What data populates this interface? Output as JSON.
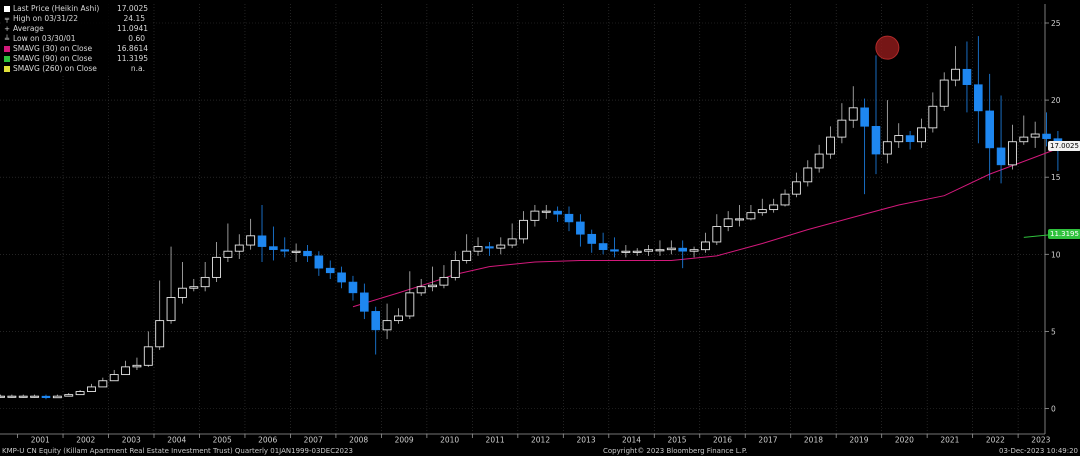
{
  "legend": {
    "last_price": {
      "label": "Last Price (Heikin Ashi)",
      "value": "17.0025"
    },
    "high": {
      "label": "High on 03/31/22",
      "value": "24.15"
    },
    "average": {
      "label": "Average",
      "value": "11.0941"
    },
    "low": {
      "label": "Low on 03/30/01",
      "value": "0.60"
    },
    "smavg30": {
      "label": "SMAVG (30)  on Close",
      "value": "16.8614"
    },
    "smavg90": {
      "label": "SMAVG (90)  on Close",
      "value": "11.3195"
    },
    "smavg260": {
      "label": "SMAVG (260)  on Close",
      "value": "n.a."
    }
  },
  "footer": {
    "left": "KMP-U CN Equity (Killam Apartment Real Estate Investment Trust)  Quarterly 01JAN1999-03DEC2023",
    "copyright": "Copyright© 2023 Bloomberg Finance L.P.",
    "timestamp": "03-Dec-2023 10:49:20"
  },
  "tags": {
    "last_price": "17.0025",
    "smavg90": "11.3195"
  },
  "colors": {
    "background": "#000000",
    "up_candle": "#e8e8e8",
    "down_candle": "#1e87f0",
    "smavg30": "#d3197b",
    "smavg90": "#2fc23d",
    "smavg260": "#e0e03a",
    "grid": "#3a3a3a",
    "high_marker": "#8b1a1a"
  },
  "chart_data": {
    "type": "candlestick",
    "style": "Heikin Ashi",
    "frequency": "Quarterly",
    "title": "",
    "xlabel": "",
    "ylabel": "",
    "ylim": [
      -1,
      26
    ],
    "yticks": [
      0,
      5,
      10,
      15,
      20,
      25
    ],
    "xticks": [
      "2001",
      "2002",
      "2003",
      "2004",
      "2005",
      "2006",
      "2007",
      "2008",
      "2009",
      "2010",
      "2011",
      "2012",
      "2013",
      "2014",
      "2015",
      "2016",
      "2017",
      "2018",
      "2019",
      "2020",
      "2021",
      "2022",
      "2023"
    ],
    "grid": true,
    "legend_position": "top-left",
    "quarters": [
      "2000Q3",
      "2000Q4",
      "2001Q1",
      "2001Q2",
      "2001Q3",
      "2001Q4",
      "2002Q1",
      "2002Q2",
      "2002Q3",
      "2002Q4",
      "2003Q1",
      "2003Q2",
      "2003Q3",
      "2003Q4",
      "2004Q1",
      "2004Q2",
      "2004Q3",
      "2004Q4",
      "2005Q1",
      "2005Q2",
      "2005Q3",
      "2005Q4",
      "2006Q1",
      "2006Q2",
      "2006Q3",
      "2006Q4",
      "2007Q1",
      "2007Q2",
      "2007Q3",
      "2007Q4",
      "2008Q1",
      "2008Q2",
      "2008Q3",
      "2008Q4",
      "2009Q1",
      "2009Q2",
      "2009Q3",
      "2009Q4",
      "2010Q1",
      "2010Q2",
      "2010Q3",
      "2010Q4",
      "2011Q1",
      "2011Q2",
      "2011Q3",
      "2011Q4",
      "2012Q1",
      "2012Q2",
      "2012Q3",
      "2012Q4",
      "2013Q1",
      "2013Q2",
      "2013Q3",
      "2013Q4",
      "2014Q1",
      "2014Q2",
      "2014Q3",
      "2014Q4",
      "2015Q1",
      "2015Q2",
      "2015Q3",
      "2015Q4",
      "2016Q1",
      "2016Q2",
      "2016Q3",
      "2016Q4",
      "2017Q1",
      "2017Q2",
      "2017Q3",
      "2017Q4",
      "2018Q1",
      "2018Q2",
      "2018Q3",
      "2018Q4",
      "2019Q1",
      "2019Q2",
      "2019Q3",
      "2019Q4",
      "2020Q1",
      "2020Q2",
      "2020Q3",
      "2020Q4",
      "2021Q1",
      "2021Q2",
      "2021Q3",
      "2021Q4",
      "2022Q1",
      "2022Q2",
      "2022Q3",
      "2022Q4",
      "2023Q1",
      "2023Q2",
      "2023Q3",
      "2023Q4"
    ],
    "series": [
      {
        "name": "Last Price (Heikin Ashi)",
        "open": [
          0.8,
          0.8,
          0.8,
          0.8,
          0.8,
          0.7,
          0.8,
          0.9,
          1.1,
          1.4,
          1.8,
          2.2,
          2.7,
          2.8,
          4.0,
          5.7,
          7.2,
          7.8,
          7.9,
          8.5,
          9.8,
          10.2,
          10.6,
          11.2,
          10.5,
          10.3,
          10.2,
          10.2,
          9.9,
          9.1,
          8.8,
          8.2,
          7.5,
          6.3,
          5.1,
          5.7,
          6.0,
          7.5,
          7.9,
          8.0,
          8.5,
          9.6,
          10.2,
          10.5,
          10.4,
          10.6,
          11.0,
          12.2,
          12.8,
          12.8,
          12.6,
          12.1,
          11.3,
          10.7,
          10.3,
          10.2,
          10.2,
          10.2,
          10.3,
          10.3,
          10.4,
          10.2,
          10.3,
          10.8,
          11.8,
          12.3,
          12.3,
          12.7,
          12.9,
          13.2,
          13.9,
          14.7,
          15.6,
          16.5,
          17.6,
          18.7,
          19.5,
          18.3,
          16.5,
          17.3,
          17.7,
          17.3,
          18.2,
          19.6,
          21.3,
          22.0,
          21.0,
          19.3,
          16.9,
          15.8,
          17.3,
          17.6,
          17.8,
          17.5
        ],
        "close": [
          0.8,
          0.8,
          0.8,
          0.8,
          0.7,
          0.8,
          0.9,
          1.1,
          1.4,
          1.8,
          2.2,
          2.7,
          2.8,
          4.0,
          5.7,
          7.2,
          7.8,
          7.9,
          8.5,
          9.8,
          10.2,
          10.6,
          11.2,
          10.5,
          10.3,
          10.2,
          10.2,
          9.9,
          9.1,
          8.8,
          8.2,
          7.5,
          6.3,
          5.1,
          5.7,
          6.0,
          7.5,
          7.9,
          8.0,
          8.5,
          9.6,
          10.2,
          10.5,
          10.4,
          10.6,
          11.0,
          12.2,
          12.8,
          12.8,
          12.6,
          12.1,
          11.3,
          10.7,
          10.3,
          10.2,
          10.2,
          10.2,
          10.3,
          10.3,
          10.4,
          10.2,
          10.3,
          10.8,
          11.8,
          12.3,
          12.3,
          12.7,
          12.9,
          13.2,
          13.9,
          14.7,
          15.6,
          16.5,
          17.6,
          18.7,
          19.5,
          18.3,
          16.5,
          17.3,
          17.7,
          17.3,
          18.2,
          19.6,
          21.3,
          22.0,
          21.0,
          19.3,
          16.9,
          15.8,
          17.3,
          17.6,
          17.8,
          17.5,
          17.0
        ],
        "high": [
          0.9,
          0.9,
          0.9,
          0.9,
          0.9,
          0.9,
          1.0,
          1.2,
          1.6,
          2.0,
          2.5,
          3.1,
          3.3,
          5.0,
          8.3,
          10.5,
          9.5,
          8.4,
          9.5,
          10.8,
          12.0,
          11.3,
          12.3,
          13.2,
          11.8,
          11.1,
          10.7,
          10.6,
          10.2,
          9.6,
          9.2,
          8.6,
          8.1,
          6.6,
          6.8,
          6.5,
          8.9,
          8.4,
          9.2,
          9.3,
          10.2,
          11.3,
          11.1,
          10.8,
          11.1,
          12.0,
          12.8,
          13.2,
          13.2,
          13.1,
          13.1,
          12.6,
          11.6,
          11.4,
          11.1,
          10.6,
          10.4,
          10.6,
          10.9,
          10.9,
          10.9,
          10.5,
          11.4,
          12.6,
          12.8,
          13.2,
          13.2,
          13.6,
          13.6,
          14.2,
          15.3,
          16.1,
          17.1,
          18.3,
          19.8,
          20.9,
          20.1,
          22.9,
          20.0,
          18.5,
          18.0,
          18.8,
          20.5,
          21.8,
          23.5,
          23.8,
          24.15,
          21.7,
          20.3,
          18.4,
          19.0,
          18.6,
          19.2,
          18.0
        ],
        "low": [
          0.7,
          0.7,
          0.7,
          0.7,
          0.6,
          0.7,
          0.8,
          0.9,
          1.1,
          1.4,
          1.8,
          2.2,
          2.5,
          2.7,
          3.8,
          5.5,
          6.8,
          7.6,
          7.6,
          8.2,
          9.5,
          9.7,
          10.3,
          9.5,
          9.6,
          9.8,
          9.5,
          9.5,
          8.6,
          8.4,
          7.8,
          7.0,
          5.8,
          3.5,
          4.5,
          5.5,
          5.8,
          7.3,
          7.6,
          7.8,
          8.3,
          9.4,
          9.9,
          9.9,
          10.0,
          10.4,
          10.7,
          11.8,
          12.3,
          12.1,
          11.5,
          10.5,
          10.1,
          10.0,
          9.8,
          9.8,
          9.9,
          9.9,
          9.9,
          10.0,
          9.1,
          9.8,
          10.1,
          10.6,
          11.5,
          11.8,
          12.2,
          12.5,
          12.7,
          13.1,
          13.7,
          14.4,
          15.3,
          16.2,
          17.2,
          18.2,
          13.9,
          15.2,
          15.9,
          16.9,
          16.8,
          16.9,
          17.9,
          19.3,
          20.9,
          19.2,
          17.2,
          14.8,
          14.6,
          15.5,
          17.1,
          16.9,
          17.0,
          15.4
        ]
      },
      {
        "name": "SMAVG (30)  on Close",
        "x": [
          "2008Q2",
          "2009Q2",
          "2010Q1",
          "2010Q3",
          "2011Q2",
          "2012Q2",
          "2013Q2",
          "2014Q2",
          "2015Q2",
          "2016Q2",
          "2017Q2",
          "2018Q2",
          "2019Q2",
          "2020Q2",
          "2021Q2",
          "2022Q2",
          "2023Q2",
          "2023Q4"
        ],
        "values": [
          6.6,
          7.5,
          8.2,
          8.7,
          9.2,
          9.5,
          9.6,
          9.6,
          9.6,
          9.9,
          10.7,
          11.6,
          12.4,
          13.2,
          13.8,
          15.2,
          16.3,
          16.86
        ]
      },
      {
        "name": "SMAVG (90)  on Close",
        "x": [
          "2023Q1",
          "2023Q4"
        ],
        "values": [
          11.1,
          11.32
        ]
      },
      {
        "name": "SMAVG (260)  on Close",
        "x": [],
        "values": []
      }
    ],
    "annotations": [
      {
        "type": "marker",
        "at": "2020Q1",
        "y": 23.4,
        "color": "#8b1a1a"
      }
    ]
  }
}
